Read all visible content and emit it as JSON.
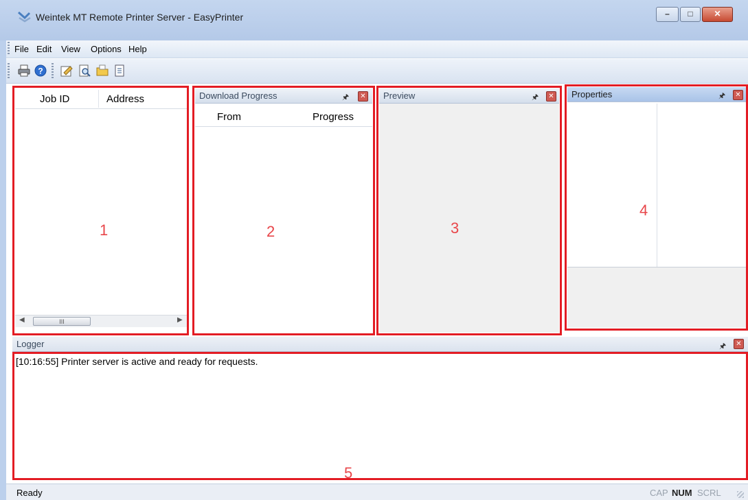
{
  "window": {
    "title": "Weintek MT Remote Printer Server - EasyPrinter"
  },
  "menu": [
    {
      "label": "File"
    },
    {
      "label": "Edit"
    },
    {
      "label": "View"
    },
    {
      "label": "Options"
    },
    {
      "label": "Help"
    }
  ],
  "jobs_panel": {
    "columns": [
      "Job ID",
      "Address"
    ],
    "scroll_thumb": "III"
  },
  "download_panel": {
    "title": "Download Progress",
    "columns": [
      "From",
      "Progress"
    ]
  },
  "preview_panel": {
    "title": "Preview"
  },
  "properties_panel": {
    "title": "Properties"
  },
  "logger_panel": {
    "title": "Logger",
    "lines": [
      "[10:16:55] Printer server is active and ready for requests."
    ]
  },
  "annotations": [
    "1",
    "2",
    "3",
    "4",
    "5"
  ],
  "status": {
    "text": "Ready",
    "indicators": [
      "CAP",
      "NUM",
      "SCRL"
    ]
  },
  "icons": {
    "pin": "pin-icon",
    "close": "close-icon",
    "toolbar": [
      "printer-icon",
      "help-icon",
      "properties-icon",
      "print-preview-icon",
      "open-folder-icon",
      "document-icon"
    ]
  },
  "colors": {
    "highlight": "#e31c24",
    "annotation": "#e8464a",
    "panel_header_active": "#b9cfee"
  }
}
